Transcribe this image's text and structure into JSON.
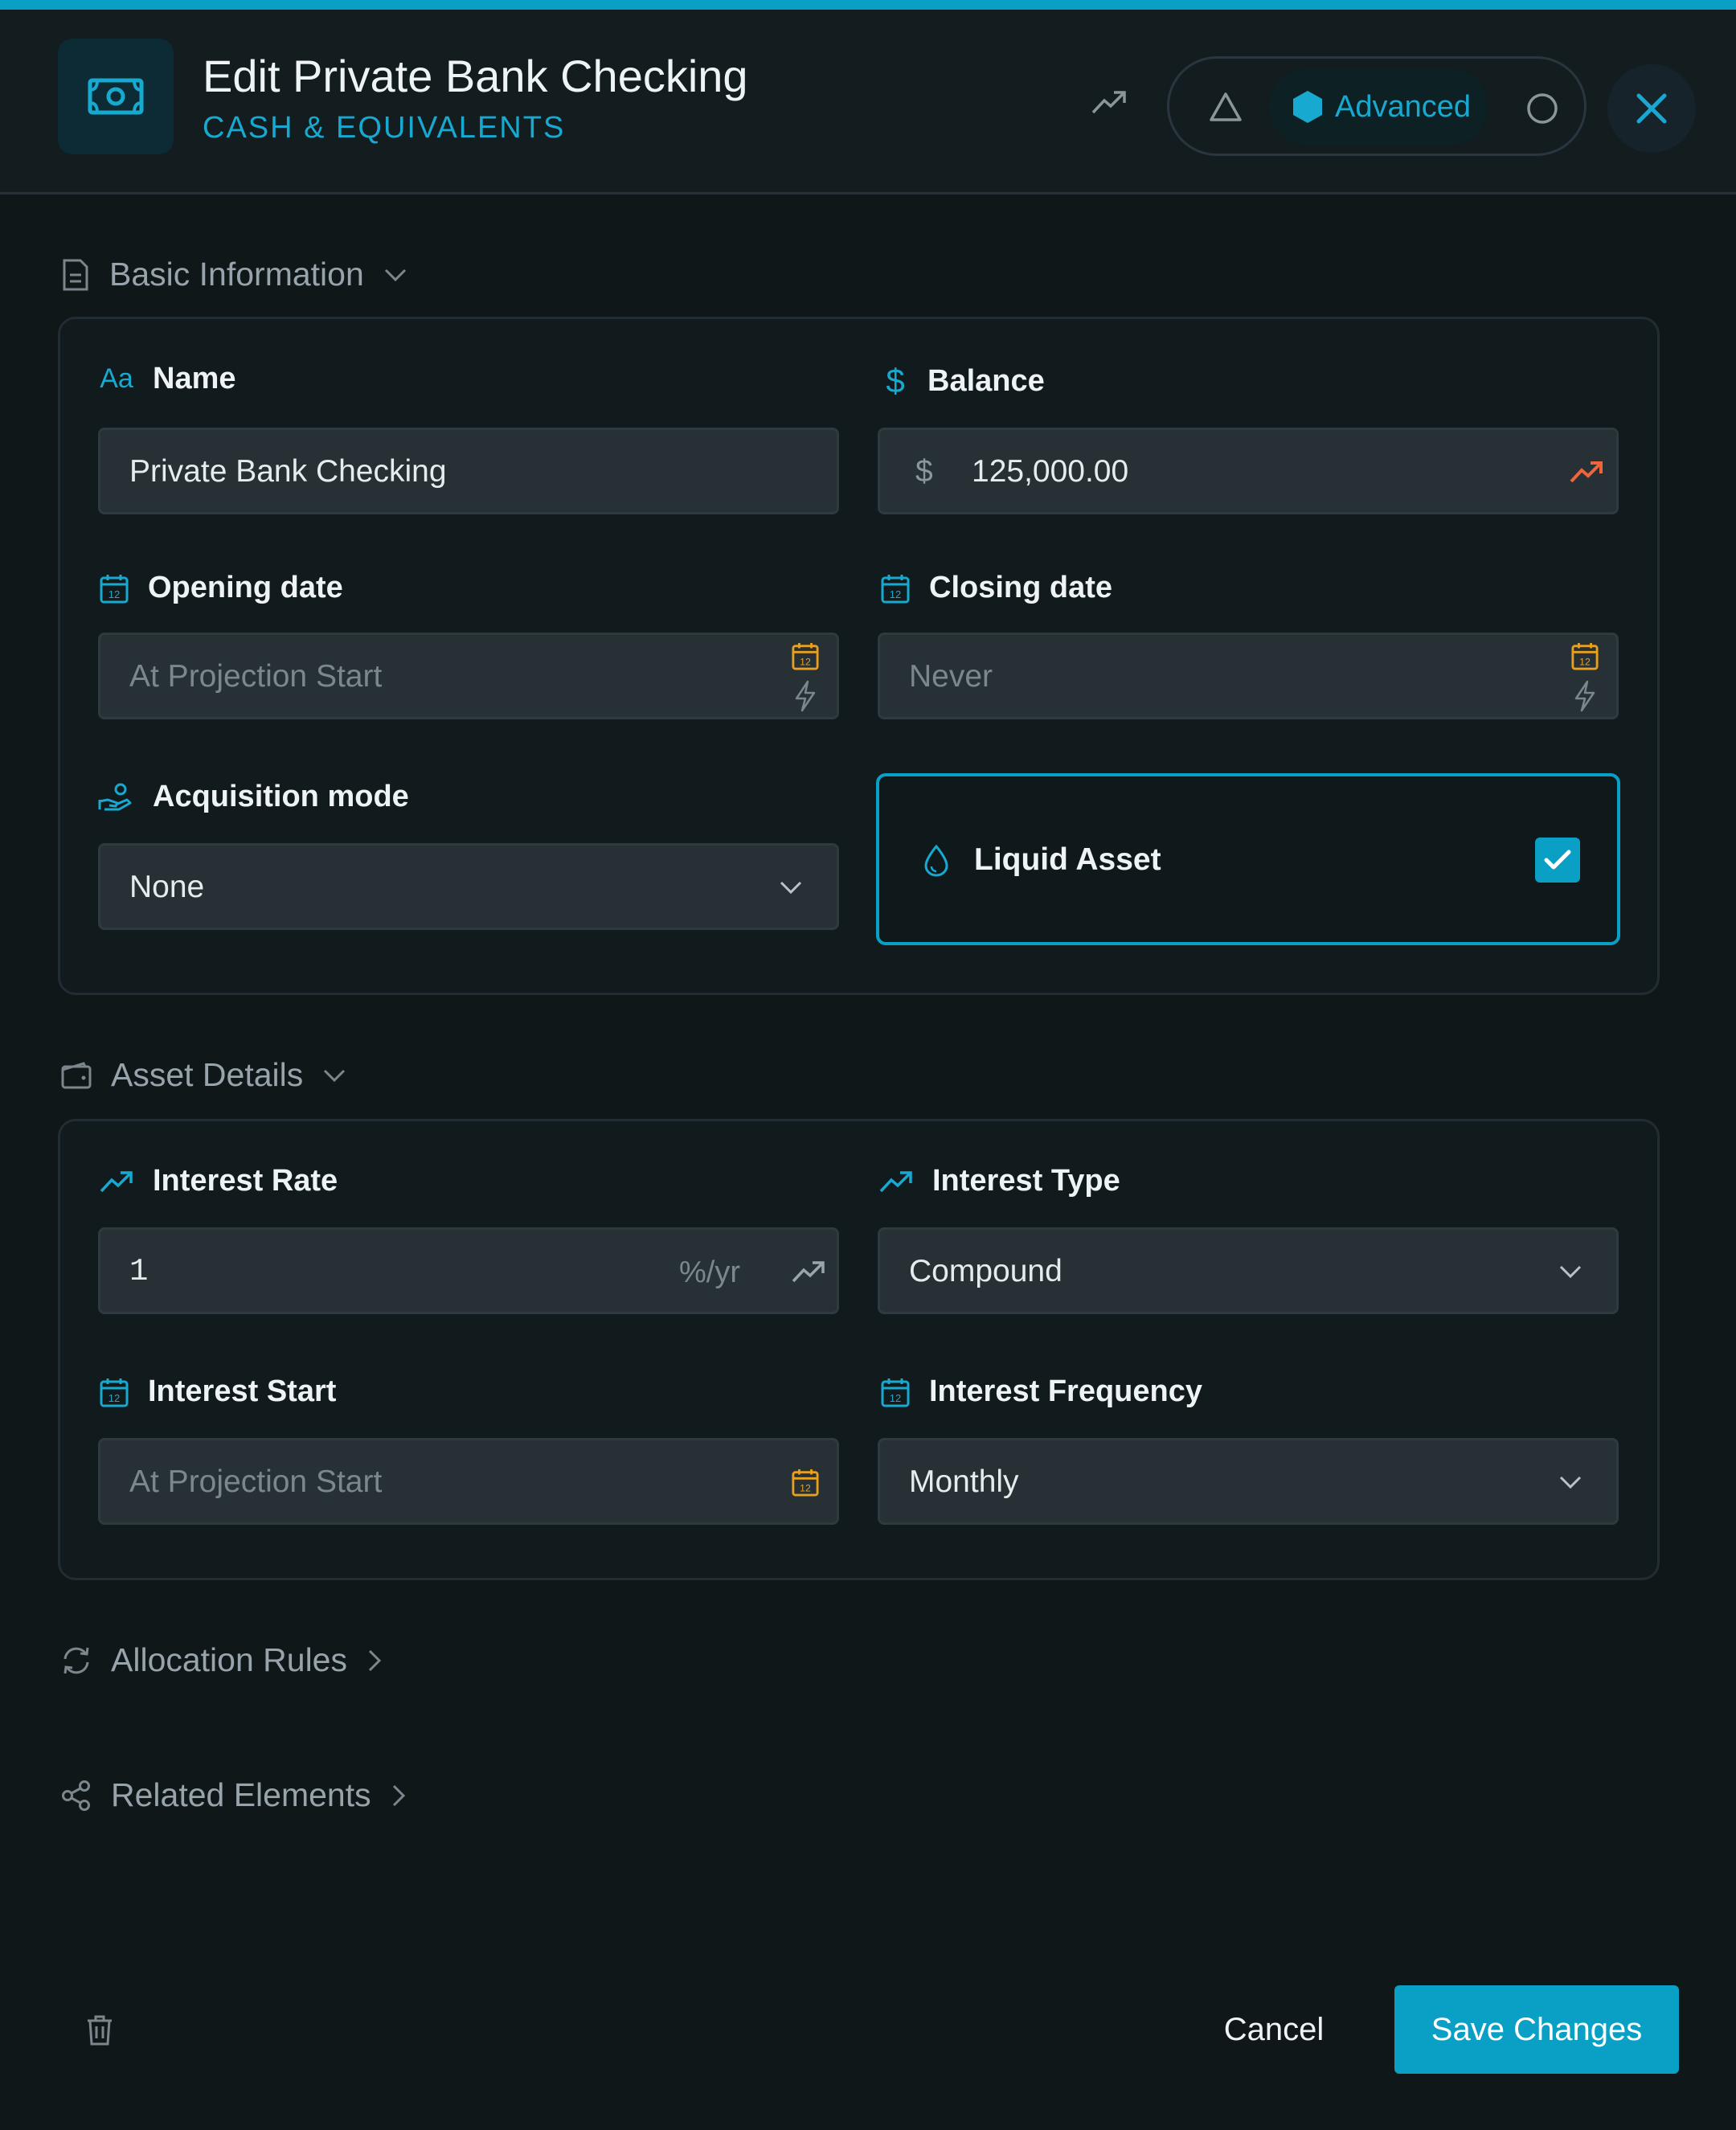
{
  "colors": {
    "accent": "#0aa0c6",
    "orange_accent": "#e8a020",
    "trend_red": "#f0643c"
  },
  "header": {
    "title": "Edit Private Bank Checking",
    "subtitle": "CASH & EQUIVALENTS",
    "mode_selected": "Advanced",
    "icons": [
      "banknote-icon",
      "trend-icon",
      "triangle-icon",
      "hexagon-icon",
      "circle-icon",
      "close-icon"
    ]
  },
  "basic_info": {
    "section_label": "Basic Information",
    "name": {
      "label": "Name",
      "value": "Private Bank Checking"
    },
    "balance": {
      "label": "Balance",
      "currency": "$",
      "value": "125,000.00"
    },
    "opening_date": {
      "label": "Opening date",
      "placeholder": "At Projection Start"
    },
    "closing_date": {
      "label": "Closing date",
      "placeholder": "Never"
    },
    "acquisition_mode": {
      "label": "Acquisition mode",
      "value": "None"
    },
    "liquid_asset": {
      "label": "Liquid Asset",
      "checked": true
    }
  },
  "asset_details": {
    "section_label": "Asset Details",
    "interest_rate": {
      "label": "Interest Rate",
      "value": "1",
      "unit": "%/yr"
    },
    "interest_type": {
      "label": "Interest Type",
      "value": "Compound"
    },
    "interest_start": {
      "label": "Interest Start",
      "placeholder": "At Projection Start"
    },
    "interest_frequency": {
      "label": "Interest Frequency",
      "value": "Monthly"
    }
  },
  "allocation_rules": {
    "label": "Allocation Rules"
  },
  "related_elements": {
    "label": "Related Elements"
  },
  "footer": {
    "cancel_label": "Cancel",
    "save_label": "Save Changes"
  }
}
